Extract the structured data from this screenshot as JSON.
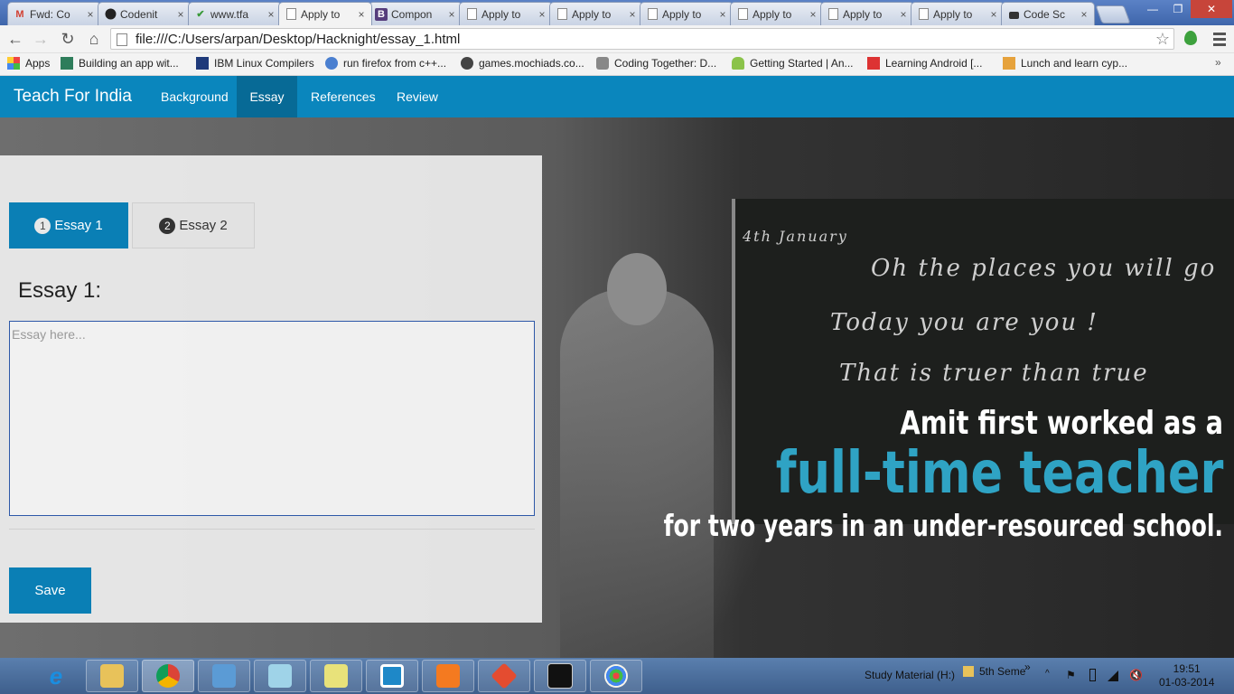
{
  "browser": {
    "tabs": [
      {
        "label": "Fwd: Co",
        "icon": "gmail-icon"
      },
      {
        "label": "Codenit",
        "icon": "github-icon"
      },
      {
        "label": "www.tfa",
        "icon": "check-icon"
      },
      {
        "label": "Apply to",
        "icon": "page-icon",
        "active": true
      },
      {
        "label": "Compon",
        "icon": "bootstrap-icon"
      },
      {
        "label": "Apply to",
        "icon": "page-icon"
      },
      {
        "label": "Apply to",
        "icon": "page-icon"
      },
      {
        "label": "Apply to",
        "icon": "page-icon"
      },
      {
        "label": "Apply to",
        "icon": "page-icon"
      },
      {
        "label": "Apply to",
        "icon": "page-icon"
      },
      {
        "label": "Apply to",
        "icon": "page-icon"
      },
      {
        "label": "Code Sc",
        "icon": "codeschool-icon"
      }
    ],
    "tab_close": "×",
    "window_controls": {
      "minimize": "—",
      "maximize": "❐",
      "close": "✕"
    },
    "url": "file:///C:/Users/arpan/Desktop/Hacknight/essay_1.html",
    "bookmarks": [
      {
        "label": "Apps",
        "icon": "apps-grid-icon"
      },
      {
        "label": "Building an app wit...",
        "icon": "bookmark-icon"
      },
      {
        "label": "IBM Linux Compilers",
        "icon": "ibm-icon"
      },
      {
        "label": "run firefox from c++...",
        "icon": "bookmark-icon"
      },
      {
        "label": "games.mochiads.co...",
        "icon": "mochi-icon"
      },
      {
        "label": "Coding Together: D...",
        "icon": "apple-icon"
      },
      {
        "label": "Getting Started | An...",
        "icon": "android-icon"
      },
      {
        "label": "Learning Android [...",
        "icon": "pdf-icon"
      },
      {
        "label": "Lunch and learn cyp...",
        "icon": "bookmark-icon"
      }
    ],
    "bookmarks_more": "»"
  },
  "site": {
    "brand": "Teach For India",
    "nav": [
      "Background",
      "Essay",
      "References",
      "Review"
    ],
    "active_nav": "Essay"
  },
  "hero": {
    "chalk_lines": [
      "Oh the places you will go",
      "Today you are you !",
      "That is truer than true"
    ],
    "chalk_date": "4th January",
    "quote_line1": "Amit first worked as a",
    "quote_line2": "full-time teacher",
    "quote_line3": "for two years in an under-resourced school."
  },
  "essay": {
    "tabs": [
      {
        "number": "1",
        "label": "Essay 1"
      },
      {
        "number": "2",
        "label": "Essay 2"
      }
    ],
    "heading": "Essay 1:",
    "placeholder": "Essay here...",
    "value": "",
    "save_label": "Save"
  },
  "taskbar": {
    "tray_drive": "Study Material (H:)",
    "tray_folder": "5th Seme",
    "tray_more": "»",
    "time": "19:51",
    "date": "01-03-2014"
  },
  "colors": {
    "navbar": "#0a86bd",
    "nav_active": "#076a96",
    "button": "#0a7fb5",
    "quote_accent": "#2fa3c4"
  }
}
